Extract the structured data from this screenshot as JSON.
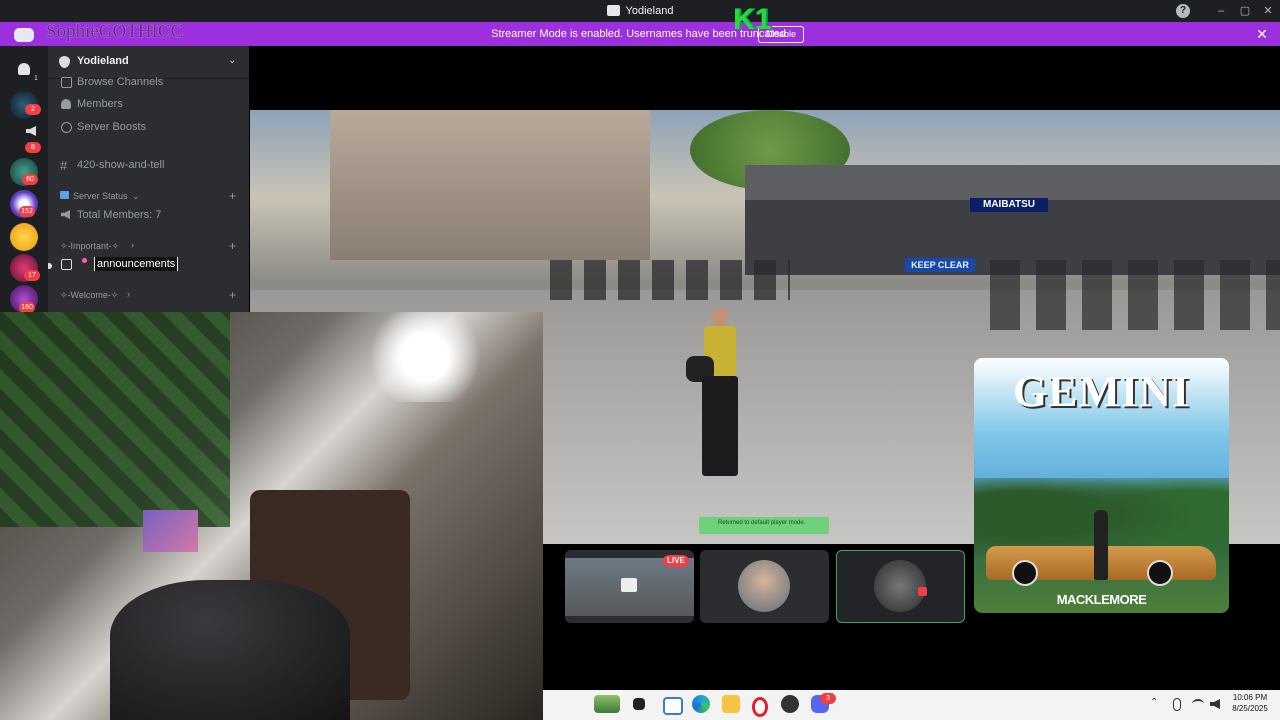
{
  "window": {
    "title": "Yodieland",
    "help_icon": "help-icon",
    "minimize": "–",
    "maximize": "▢",
    "close": "✕"
  },
  "overlay": {
    "name": "SophieGOTHICC",
    "tag": "K1"
  },
  "banner": {
    "text": "Streamer Mode is enabled. Usernames have been truncated.",
    "disable_label": "Disable",
    "close": "✕"
  },
  "rail": {
    "badges": [
      "1",
      "2",
      "8",
      "60",
      "152",
      "17",
      "160"
    ]
  },
  "sidebar": {
    "server_name": "Yodieland",
    "items": [
      {
        "label": "Browse Channels",
        "icon": "browse-channels-icon"
      },
      {
        "label": "Members",
        "icon": "members-icon"
      },
      {
        "label": "Server Boosts",
        "icon": "boost-icon"
      }
    ],
    "text_channel": "420-show-and-tell",
    "server_status": {
      "label": "Server Status",
      "members": "Total Members: 7"
    },
    "important": {
      "label": "✧-Important-✧",
      "channel": "announcements"
    },
    "welcome": {
      "label": "✧-Welcome-✧"
    }
  },
  "game": {
    "sign_left": "MAIBATSU",
    "sign_keep": "KEEP CLEAR",
    "toast": "Returned to default player mode."
  },
  "album": {
    "title": "GEMINI",
    "artist": "MACKLEMORE"
  },
  "tiles": {
    "live_label": "LIVE"
  },
  "taskbar": {
    "time": "10:06 PM",
    "date": "8/25/2025",
    "notif_count": "3"
  }
}
